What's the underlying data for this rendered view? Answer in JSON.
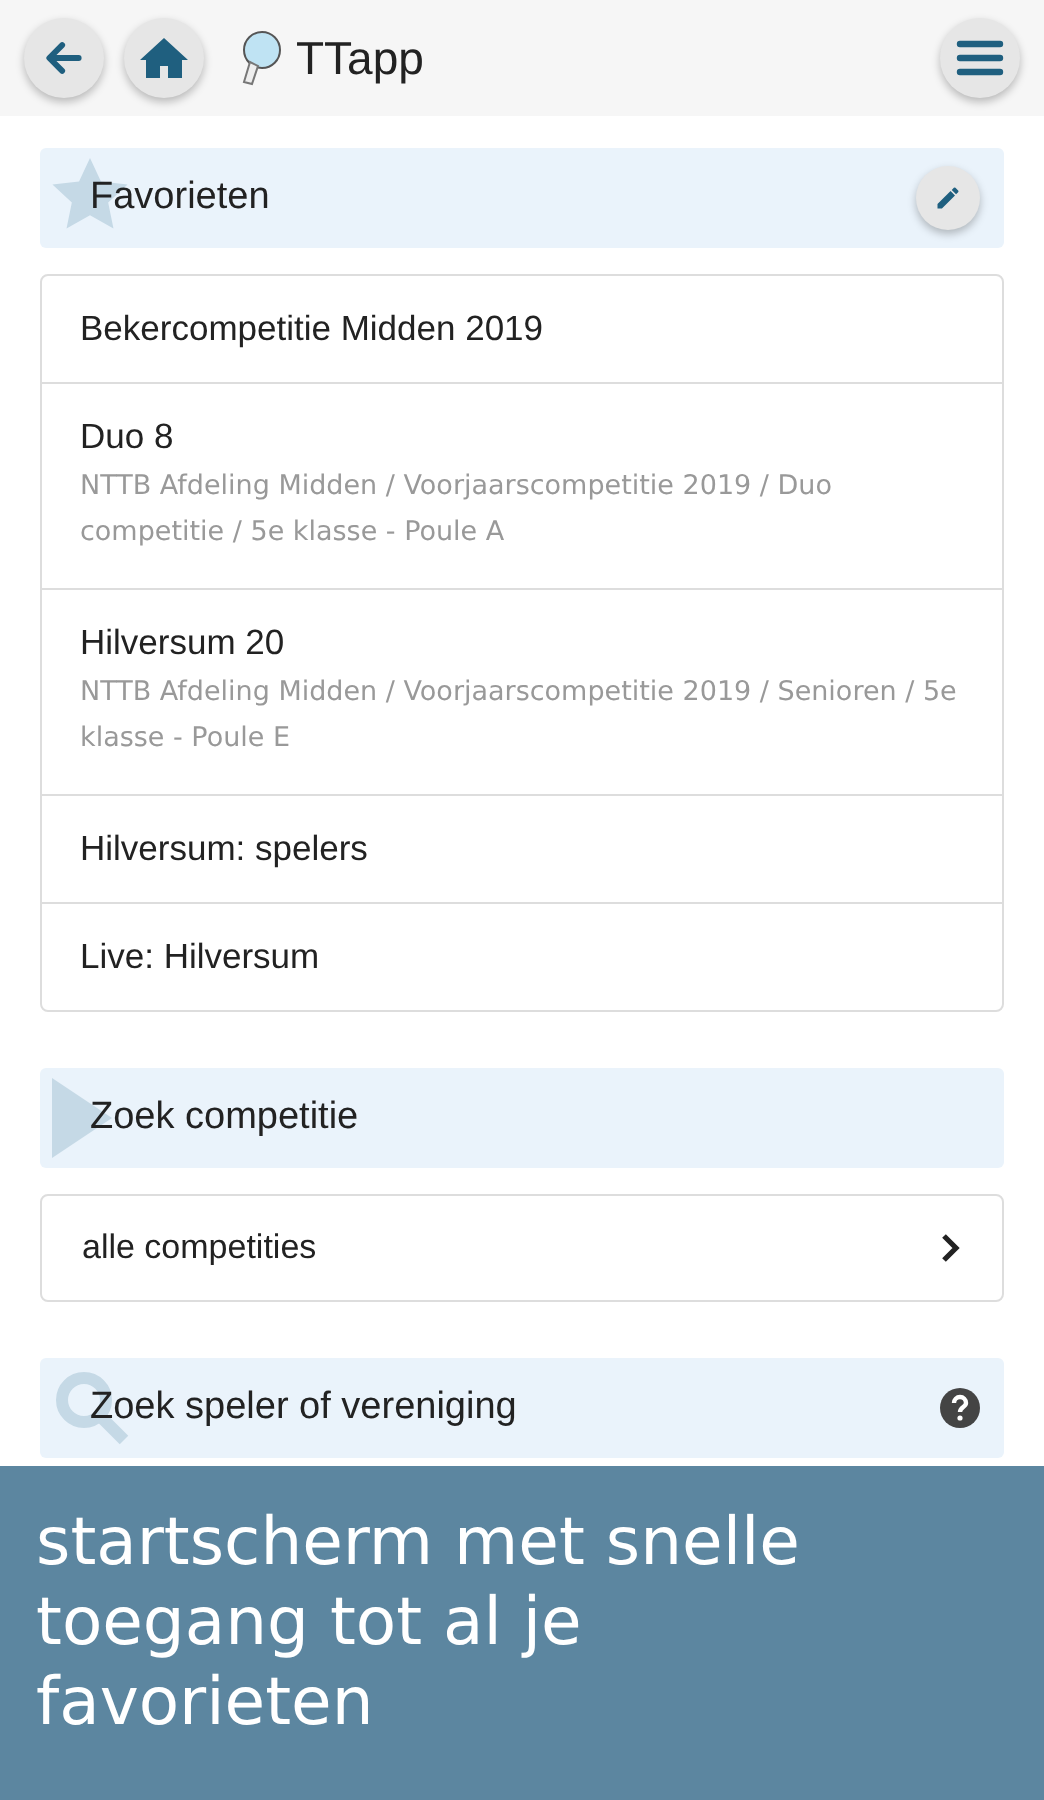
{
  "header": {
    "title": "TTapp"
  },
  "favorites": {
    "title": "Favorieten",
    "items": [
      {
        "title": "Bekercompetitie Midden 2019"
      },
      {
        "title": "Duo 8",
        "subtitle": "NTTB Afdeling Midden / Voorjaarscompetitie 2019 / Duo competitie / 5e klasse - Poule A"
      },
      {
        "title": "Hilversum 20",
        "subtitle": "NTTB Afdeling Midden / Voorjaarscompetitie 2019 / Senioren / 5e klasse - Poule E"
      },
      {
        "title": "Hilversum: spelers"
      },
      {
        "title": "Live: Hilversum"
      }
    ]
  },
  "competition": {
    "title": "Zoek competitie",
    "option": "alle competities"
  },
  "player_search": {
    "title": "Zoek speler of vereniging"
  },
  "caption": {
    "lines": [
      "startscherm met snelle",
      "toegang tot al je",
      "favorieten"
    ]
  }
}
